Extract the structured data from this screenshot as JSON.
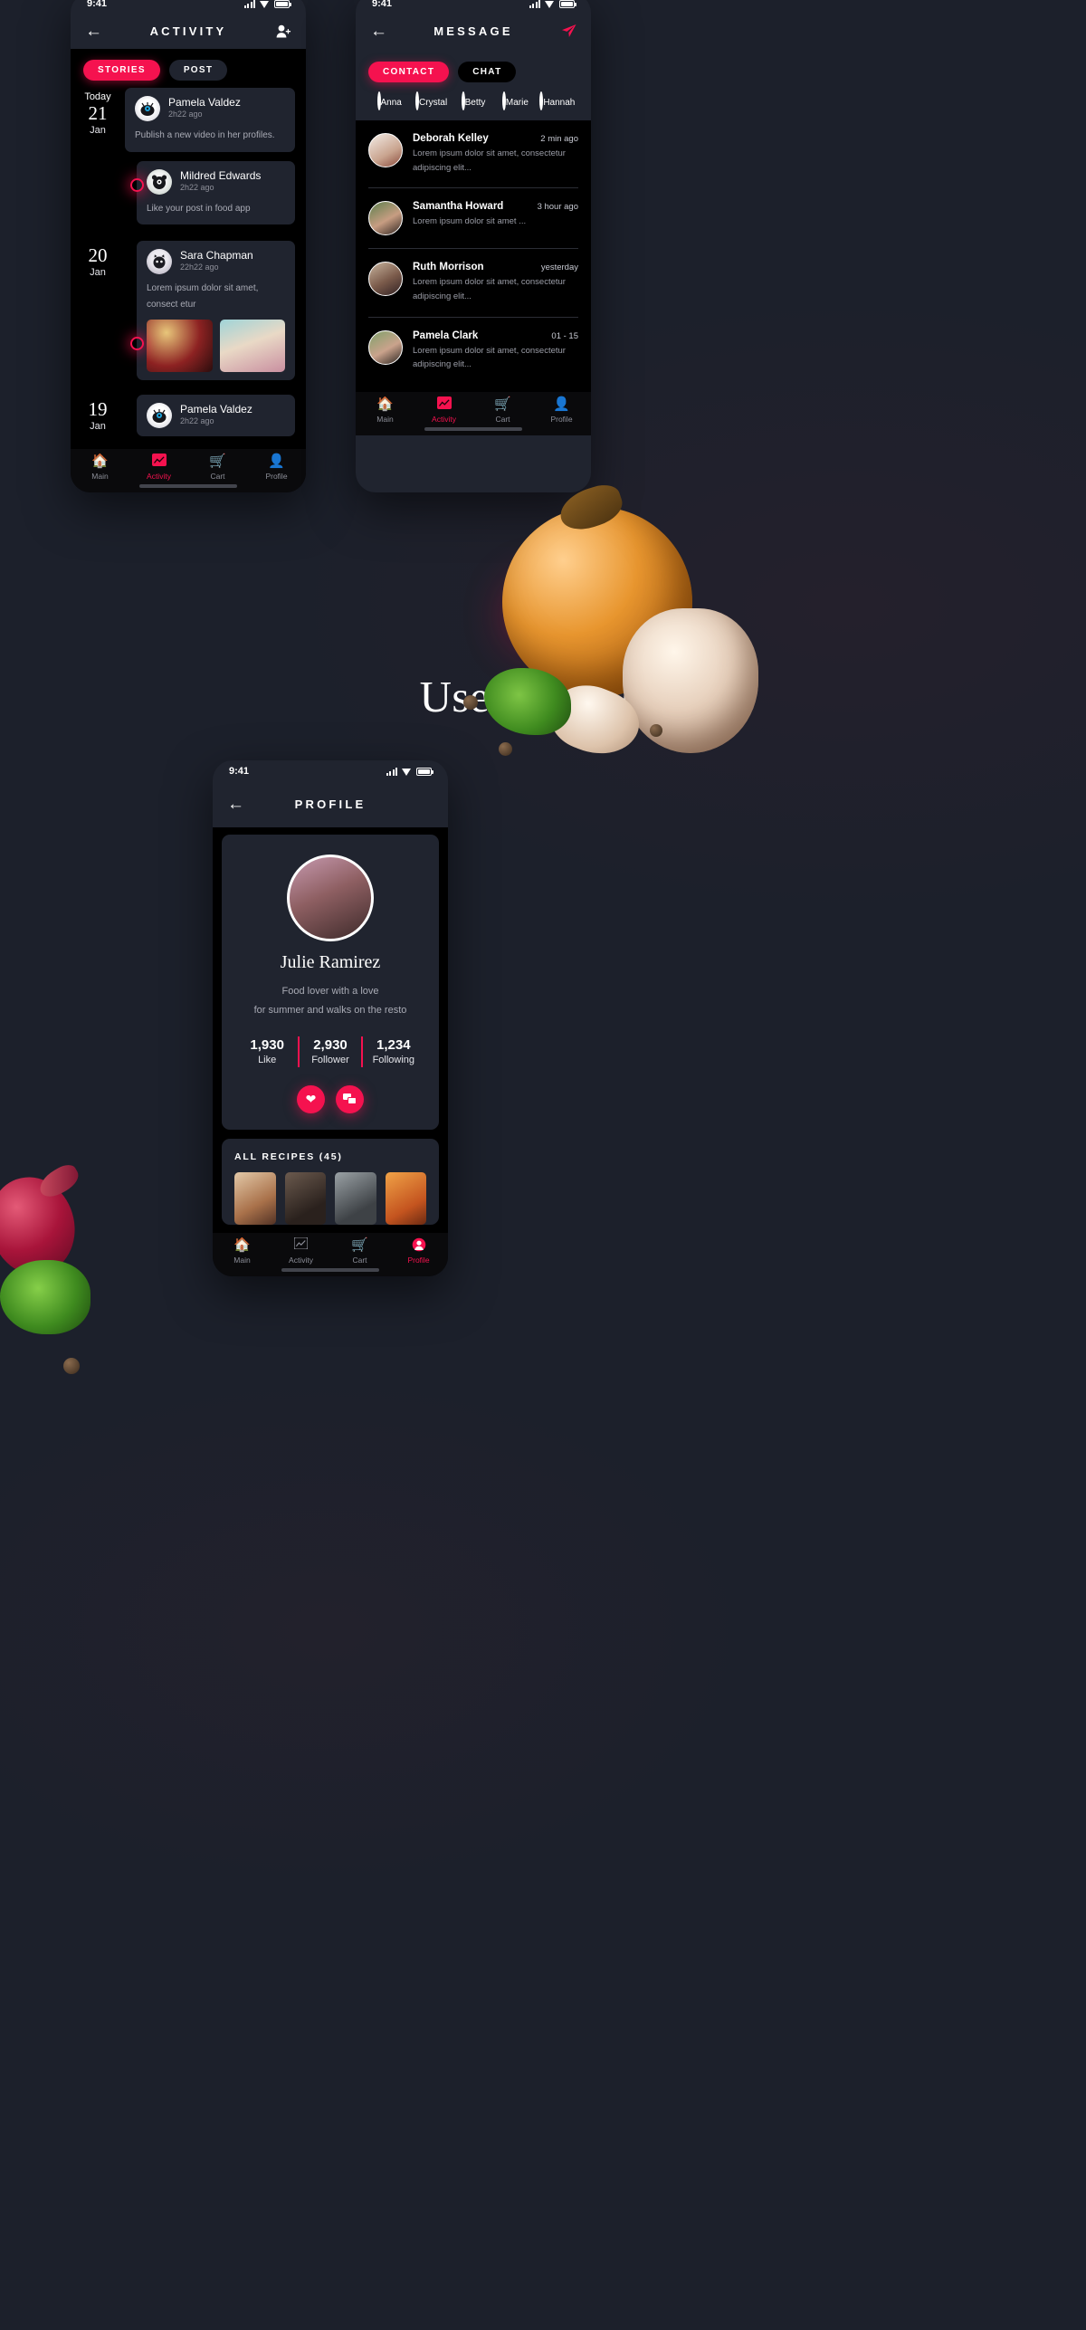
{
  "brand": {
    "accent": "#f5124f",
    "panel": "#20242f",
    "screen": "#000000",
    "page_bg": "#1c202b"
  },
  "hero": {
    "title": "User Account",
    "logo_icon": "ring-logo-icon"
  },
  "activity_phone": {
    "status": {
      "time": "9:41",
      "signal_icon": "signal-icon",
      "wifi_icon": "wifi-icon",
      "battery_icon": "battery-icon"
    },
    "header": {
      "back_icon": "back-arrow-icon",
      "title": "ACTIVITY",
      "action_icon": "add-user-icon"
    },
    "tabs": [
      {
        "label": "STORIES",
        "active": true
      },
      {
        "label": "POST",
        "active": false
      }
    ],
    "groups": [
      {
        "day_label": "Today",
        "day_number": "21",
        "month": "Jan",
        "items": [
          {
            "name": "Pamela Valdez",
            "time": "2h22 ago",
            "text": "Publish a new video in her profiles.",
            "avatar_icon": "owl-avatar-icon",
            "images": []
          },
          {
            "name": "Mildred Edwards",
            "time": "2h22 ago",
            "text": "Like your post in food app",
            "avatar_icon": "panda-avatar-icon",
            "images": []
          }
        ]
      },
      {
        "day_label": "",
        "day_number": "20",
        "month": "Jan",
        "items": [
          {
            "name": "Sara Chapman",
            "time": "22h22 ago",
            "text": "Lorem ipsum dolor sit amet,  consect etur",
            "avatar_icon": "cat-avatar-icon",
            "images": [
              "wine-glass-photo",
              "phone-food-photo"
            ]
          }
        ]
      },
      {
        "day_label": "",
        "day_number": "19",
        "month": "Jan",
        "items": [
          {
            "name": "Pamela Valdez",
            "time": "2h22 ago",
            "text": "",
            "avatar_icon": "owl-avatar-icon",
            "images": []
          }
        ]
      }
    ],
    "nav": [
      {
        "label": "Main",
        "icon": "home-icon",
        "active": false
      },
      {
        "label": "Activity",
        "icon": "chart-icon",
        "active": true
      },
      {
        "label": "Cart",
        "icon": "cart-icon",
        "active": false
      },
      {
        "label": "Profile",
        "icon": "person-icon",
        "active": false
      }
    ]
  },
  "message_phone": {
    "status": {
      "time": "9:41",
      "signal_icon": "signal-icon",
      "wifi_icon": "wifi-icon",
      "battery_icon": "battery-icon"
    },
    "header": {
      "back_icon": "back-arrow-icon",
      "title": "MESSAGE",
      "action_icon": "send-paper-plane-icon"
    },
    "tabs": [
      {
        "label": "CONTACT",
        "active": true
      },
      {
        "label": "CHAT",
        "active": false
      }
    ],
    "contacts": [
      {
        "name": "Anna"
      },
      {
        "name": "Crystal"
      },
      {
        "name": "Betty"
      },
      {
        "name": "Marie"
      },
      {
        "name": "Hannah"
      }
    ],
    "messages": [
      {
        "name": "Deborah Kelley",
        "time": "2 min ago",
        "text": "Lorem ipsum dolor sit amet, consectetur adipiscing elit..."
      },
      {
        "name": "Samantha Howard",
        "time": "3 hour ago",
        "text": "Lorem ipsum dolor sit amet ..."
      },
      {
        "name": "Ruth Morrison",
        "time": "yesterday",
        "text": "Lorem ipsum dolor sit amet, consectetur adipiscing elit..."
      },
      {
        "name": "Pamela Clark",
        "time": "01 - 15",
        "text": "Lorem ipsum dolor sit amet, consectetur adipiscing elit..."
      }
    ],
    "nav": [
      {
        "label": "Main",
        "icon": "home-icon",
        "active": false
      },
      {
        "label": "Activity",
        "icon": "chart-icon",
        "active": true
      },
      {
        "label": "Cart",
        "icon": "cart-icon",
        "active": false
      },
      {
        "label": "Profile",
        "icon": "person-icon",
        "active": false
      }
    ]
  },
  "profile_phone": {
    "status": {
      "time": "9:41",
      "signal_icon": "signal-icon",
      "wifi_icon": "wifi-icon",
      "battery_icon": "battery-icon"
    },
    "header": {
      "back_icon": "back-arrow-icon",
      "title": "PROFILE"
    },
    "user": {
      "name": "Julie Ramirez",
      "bio_line1": "Food lover with a love",
      "bio_line2": "for summer and walks on the resto",
      "avatar_icon": "user-photo-avatar"
    },
    "stats": [
      {
        "value": "1,930",
        "label": "Like"
      },
      {
        "value": "2,930",
        "label": "Follower"
      },
      {
        "value": "1,234",
        "label": "Following"
      }
    ],
    "actions": [
      {
        "icon": "heart-icon"
      },
      {
        "icon": "chat-bubbles-icon"
      }
    ],
    "recipes": {
      "title": "ALL RECIPES (45)",
      "thumbs": [
        "recipe-bread-photo",
        "recipe-dark-photo",
        "recipe-pan-photo",
        "recipe-carrot-photo"
      ]
    },
    "nav": [
      {
        "label": "Main",
        "icon": "home-icon",
        "active": false
      },
      {
        "label": "Activity",
        "icon": "chart-icon",
        "active": false
      },
      {
        "label": "Cart",
        "icon": "cart-icon",
        "active": false
      },
      {
        "label": "Profile",
        "icon": "person-icon",
        "active": true
      }
    ]
  }
}
